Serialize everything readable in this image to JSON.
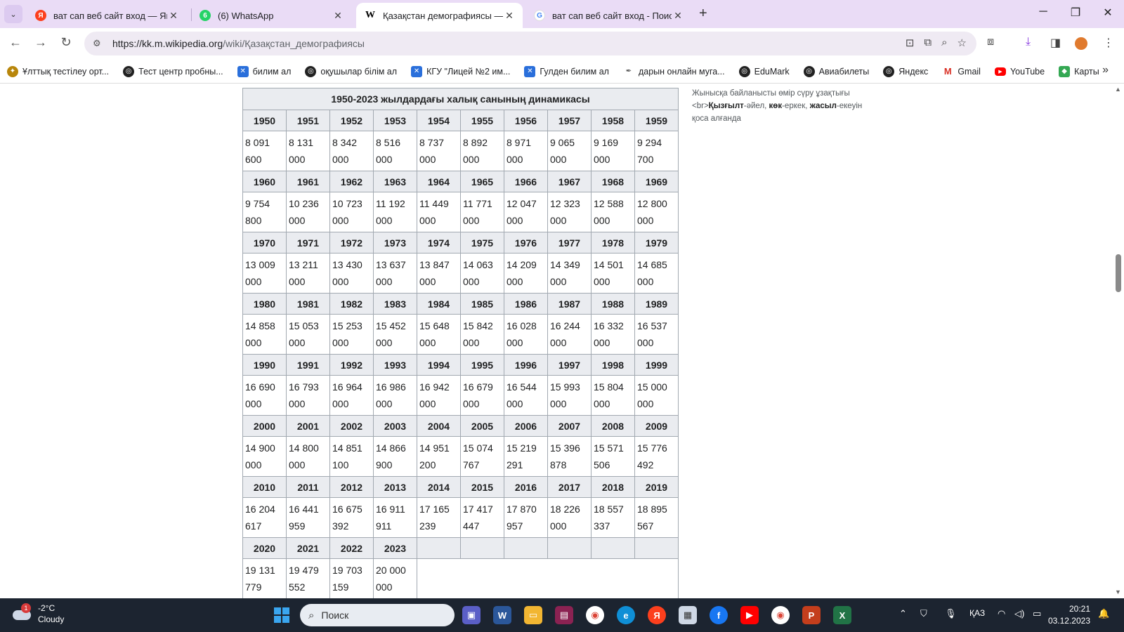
{
  "browser": {
    "tabs": [
      {
        "title": "ват сап веб сайт вход — Яндекс",
        "icon": "yandex-icon",
        "close": "✕"
      },
      {
        "title": "(6) WhatsApp",
        "icon": "whatsapp-icon",
        "close": "✕"
      },
      {
        "title": "Қазақстан демографиясы — Уикипедия",
        "icon": "wikipedia-icon",
        "close": "✕",
        "active": true
      },
      {
        "title": "ват сап веб сайт вход - Поиск",
        "icon": "google-icon",
        "close": "✕"
      }
    ],
    "url_host": "https://kk.m.wikipedia.org",
    "url_path": "/wiki/Қазақстан_демографиясы"
  },
  "bookmarks": [
    {
      "label": "Ұлттық тестілеу орт...",
      "icon": "ntc-icon",
      "color": "#b8860b"
    },
    {
      "label": "Тест центр пробны...",
      "icon": "globe-icon",
      "color": "#222"
    },
    {
      "label": "билим ал",
      "icon": "bilimal-icon",
      "color": "#2a6fdb"
    },
    {
      "label": "оқушылар білім ал",
      "icon": "globe-icon",
      "color": "#222"
    },
    {
      "label": "КГУ \"Лицей №2 им...",
      "icon": "bilimal-icon",
      "color": "#2a6fdb"
    },
    {
      "label": "Гулден билим ал",
      "icon": "bilimal-icon",
      "color": "#2a6fdb"
    },
    {
      "label": "дарын онлайн муга...",
      "icon": "feather-icon",
      "color": "#555"
    },
    {
      "label": "EduMark",
      "icon": "globe-icon",
      "color": "#222"
    },
    {
      "label": "Авиабилеты",
      "icon": "globe-icon",
      "color": "#222"
    },
    {
      "label": "Яндекс",
      "icon": "globe-icon",
      "color": "#222"
    },
    {
      "label": "Gmail",
      "icon": "gmail-icon",
      "color": "#d93025"
    },
    {
      "label": "YouTube",
      "icon": "youtube-icon",
      "color": "#ff0000"
    },
    {
      "label": "Карты",
      "icon": "maps-icon",
      "color": "#34a853"
    }
  ],
  "table": {
    "caption": "1950-2023 жылдардағы халық санының динамикасы",
    "rows": [
      {
        "years": [
          "1950",
          "1951",
          "1952",
          "1953",
          "1954",
          "1955",
          "1956",
          "1957",
          "1958",
          "1959"
        ],
        "values": [
          [
            "8 091",
            "600"
          ],
          [
            "8 131",
            "000"
          ],
          [
            "8 342",
            "000"
          ],
          [
            "8 516",
            "000"
          ],
          [
            "8 737",
            "000"
          ],
          [
            "8 892",
            "000"
          ],
          [
            "8 971",
            "000"
          ],
          [
            "9 065",
            "000"
          ],
          [
            "9 169",
            "000"
          ],
          [
            "9 294",
            "700"
          ]
        ]
      },
      {
        "years": [
          "1960",
          "1961",
          "1962",
          "1963",
          "1964",
          "1965",
          "1966",
          "1967",
          "1968",
          "1969"
        ],
        "values": [
          [
            "9 754",
            "800"
          ],
          [
            "10 236",
            "000"
          ],
          [
            "10 723",
            "000"
          ],
          [
            "11 192",
            "000"
          ],
          [
            "11 449",
            "000"
          ],
          [
            "11 771",
            "000"
          ],
          [
            "12 047",
            "000"
          ],
          [
            "12 323",
            "000"
          ],
          [
            "12 588",
            "000"
          ],
          [
            "12 800",
            "000"
          ]
        ]
      },
      {
        "years": [
          "1970",
          "1971",
          "1972",
          "1973",
          "1974",
          "1975",
          "1976",
          "1977",
          "1978",
          "1979"
        ],
        "values": [
          [
            "13 009",
            "000"
          ],
          [
            "13 211",
            "000"
          ],
          [
            "13 430",
            "000"
          ],
          [
            "13 637",
            "000"
          ],
          [
            "13 847",
            "000"
          ],
          [
            "14 063",
            "000"
          ],
          [
            "14 209",
            "000"
          ],
          [
            "14 349",
            "000"
          ],
          [
            "14 501",
            "000"
          ],
          [
            "14 685",
            "000"
          ]
        ]
      },
      {
        "years": [
          "1980",
          "1981",
          "1982",
          "1983",
          "1984",
          "1985",
          "1986",
          "1987",
          "1988",
          "1989"
        ],
        "values": [
          [
            "14 858",
            "000"
          ],
          [
            "15 053",
            "000"
          ],
          [
            "15 253",
            "000"
          ],
          [
            "15 452",
            "000"
          ],
          [
            "15 648",
            "000"
          ],
          [
            "15 842",
            "000"
          ],
          [
            "16 028",
            "000"
          ],
          [
            "16 244",
            "000"
          ],
          [
            "16 332",
            "000"
          ],
          [
            "16 537",
            "000"
          ]
        ]
      },
      {
        "years": [
          "1990",
          "1991",
          "1992",
          "1993",
          "1994",
          "1995",
          "1996",
          "1997",
          "1998",
          "1999"
        ],
        "values": [
          [
            "16 690",
            "000"
          ],
          [
            "16 793",
            "000"
          ],
          [
            "16 964",
            "000"
          ],
          [
            "16 986",
            "000"
          ],
          [
            "16 942",
            "000"
          ],
          [
            "16 679",
            "000"
          ],
          [
            "16 544",
            "000"
          ],
          [
            "15 993",
            "000"
          ],
          [
            "15 804",
            "000"
          ],
          [
            "15 000",
            "000"
          ]
        ]
      },
      {
        "years": [
          "2000",
          "2001",
          "2002",
          "2003",
          "2004",
          "2005",
          "2006",
          "2007",
          "2008",
          "2009"
        ],
        "values": [
          [
            "14 900",
            "000"
          ],
          [
            "14 800",
            "000"
          ],
          [
            "14 851",
            "100"
          ],
          [
            "14 866",
            "900"
          ],
          [
            "14 951",
            "200"
          ],
          [
            "15 074",
            "767"
          ],
          [
            "15 219",
            "291"
          ],
          [
            "15 396",
            "878"
          ],
          [
            "15 571",
            "506"
          ],
          [
            "15 776",
            "492"
          ]
        ]
      },
      {
        "years": [
          "2010",
          "2011",
          "2012",
          "2013",
          "2014",
          "2015",
          "2016",
          "2017",
          "2018",
          "2019"
        ],
        "values": [
          [
            "16 204",
            "617"
          ],
          [
            "16 441",
            "959"
          ],
          [
            "16 675",
            "392"
          ],
          [
            "16 911",
            "911"
          ],
          [
            "17 165",
            "239"
          ],
          [
            "17 417",
            "447"
          ],
          [
            "17 870",
            "957"
          ],
          [
            "18 226",
            "000"
          ],
          [
            "18 557",
            "337"
          ],
          [
            "18 895",
            "567"
          ]
        ]
      },
      {
        "years": [
          "2020",
          "2021",
          "2022",
          "2023"
        ],
        "values": [
          [
            "19 131",
            "779"
          ],
          [
            "19 479",
            "552"
          ],
          [
            "19 703",
            "159"
          ],
          [
            "20 000",
            "000"
          ]
        ]
      }
    ]
  },
  "side_note": {
    "line1": "Жынысқа байланысты өмір сүру ұзақтығы",
    "br": "<br>",
    "female": "Қызғылт",
    "female_rest": "-әйел, ",
    "male": "көк",
    "male_rest": "-еркек, ",
    "both": "жасыл",
    "both_rest": "-екеуін",
    "line3": "қоса алғанда"
  },
  "taskbar": {
    "weather_temp": "-2°C",
    "weather_desc": "Cloudy",
    "weather_badge": "1",
    "search_placeholder": "Поиск",
    "lang": "ҚАЗ",
    "time": "20:21",
    "date": "03.12.2023"
  }
}
